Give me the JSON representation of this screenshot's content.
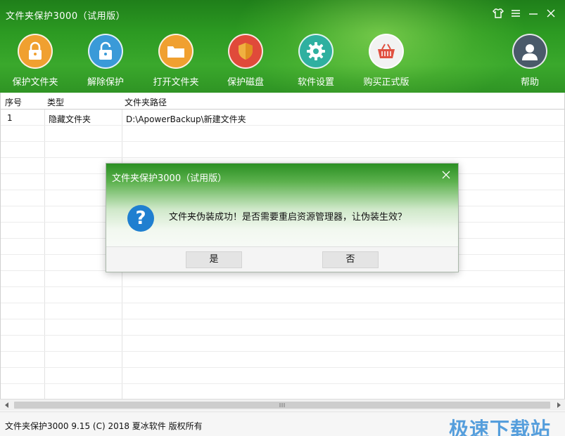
{
  "window": {
    "title": "文件夹保护3000（试用版）",
    "controls": [
      "skin-icon",
      "menu-icon",
      "minimize-icon",
      "close-icon"
    ]
  },
  "toolbar": {
    "items": [
      {
        "label": "保护文件夹",
        "icon": "lock-icon",
        "color": "#f0a030"
      },
      {
        "label": "解除保护",
        "icon": "unlock-icon",
        "color": "#3a9ad8"
      },
      {
        "label": "打开文件夹",
        "icon": "folder-icon",
        "color": "#f0a030"
      },
      {
        "label": "保护磁盘",
        "icon": "shield-icon",
        "color": "#e04a3a"
      },
      {
        "label": "软件设置",
        "icon": "gear-icon",
        "color": "#2fb0a0"
      },
      {
        "label": "购买正式版",
        "icon": "basket-icon",
        "color": "#e05040"
      },
      {
        "label": "帮助",
        "icon": "user-icon",
        "color": "#4a5a6a"
      }
    ]
  },
  "table": {
    "columns": [
      "序号",
      "类型",
      "文件夹路径"
    ],
    "rows": [
      {
        "index": "1",
        "type": "隐藏文件夹",
        "path": "D:\\ApowerBackup\\新建文件夹"
      }
    ]
  },
  "status": {
    "text": "文件夹保护3000 9.15 (C) 2018 夏冰软件 版权所有",
    "watermark": "极速下载站"
  },
  "dialog": {
    "title": "文件夹保护3000（试用版）",
    "message": "文件夹伪装成功！是否需要重启资源管理器，让伪装生效？",
    "icon": "question-icon",
    "icon_glyph": "?",
    "yes_label": "是",
    "no_label": "否"
  }
}
